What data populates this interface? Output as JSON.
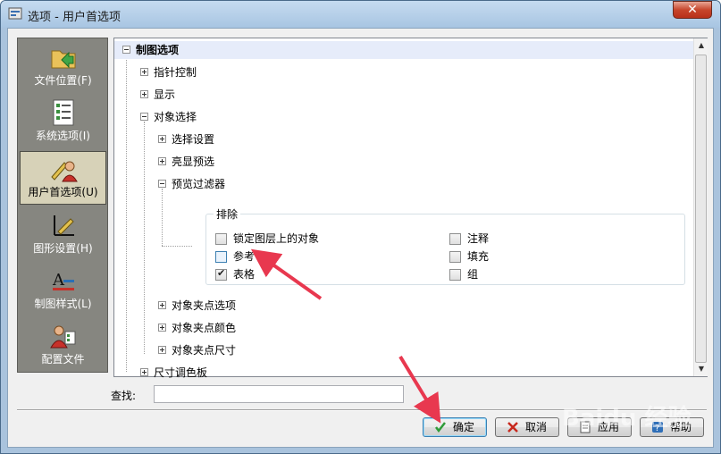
{
  "window": {
    "title": "选项 - 用户首选项"
  },
  "nav": {
    "items": [
      {
        "label": "文件位置(F)"
      },
      {
        "label": "系统选项(I)"
      },
      {
        "label": "用户首选项(U)"
      },
      {
        "label": "图形设置(H)"
      },
      {
        "label": "制图样式(L)"
      },
      {
        "label": "配置文件"
      }
    ]
  },
  "tree": {
    "root": "制图选项",
    "items": [
      "指针控制",
      "显示",
      "对象选择",
      "选择设置",
      "亮显预选",
      "预览过滤器",
      "对象夹点选项",
      "对象夹点颜色",
      "对象夹点尺寸",
      "尺寸调色板"
    ],
    "exclude_group": {
      "title": "排除",
      "options": [
        {
          "label": "锁定图层上的对象",
          "checked": false
        },
        {
          "label": "参考",
          "checked": false
        },
        {
          "label": "表格",
          "checked": true
        },
        {
          "label": "注释",
          "checked": false
        },
        {
          "label": "填充",
          "checked": false
        },
        {
          "label": "组",
          "checked": false
        }
      ]
    }
  },
  "search": {
    "label": "查找:",
    "value": ""
  },
  "buttons": {
    "ok": "确定",
    "cancel": "取消",
    "apply": "应用",
    "help": "帮助"
  },
  "watermark": "Baidu 经验",
  "colors": {
    "arrow": "#e8384f",
    "selection": "#e6ecfa",
    "nav_bg": "#868680"
  }
}
